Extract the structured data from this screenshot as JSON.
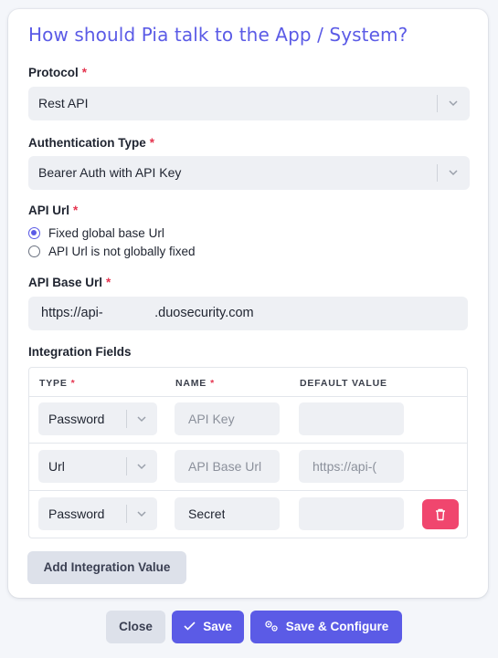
{
  "form": {
    "title": "How should Pia talk to the App / System?",
    "required_marker": "*",
    "protocol": {
      "label": "Protocol",
      "value": "Rest API"
    },
    "auth_type": {
      "label": "Authentication Type",
      "value": "Bearer Auth with API Key"
    },
    "api_url": {
      "label": "API Url",
      "options": [
        "Fixed global base Url",
        "API Url is not globally fixed"
      ],
      "selected": 0
    },
    "api_base_url": {
      "label": "API Base Url",
      "value": "https://api-              .duosecurity.com"
    }
  },
  "integration_fields": {
    "label": "Integration Fields",
    "columns": {
      "type": "TYPE",
      "name": "NAME",
      "default_value": "DEFAULT VALUE"
    },
    "rows": [
      {
        "type": "Password",
        "name": "API Key",
        "name_is_placeholder": true,
        "default_value": ""
      },
      {
        "type": "Url",
        "name": "API Base Url",
        "name_is_placeholder": true,
        "default_value": "https://api-("
      },
      {
        "type": "Password",
        "name": "Secret",
        "name_is_placeholder": false,
        "default_value": ""
      }
    ],
    "add_button": "Add Integration Value"
  },
  "footer": {
    "close": "Close",
    "save": "Save",
    "save_configure": "Save & Configure"
  },
  "colors": {
    "accent": "#5b5be6",
    "danger": "#f0466e",
    "required": "#e5344f"
  },
  "icons": [
    "chevron-down-icon",
    "trash-icon",
    "check-icon",
    "settings-icon"
  ]
}
